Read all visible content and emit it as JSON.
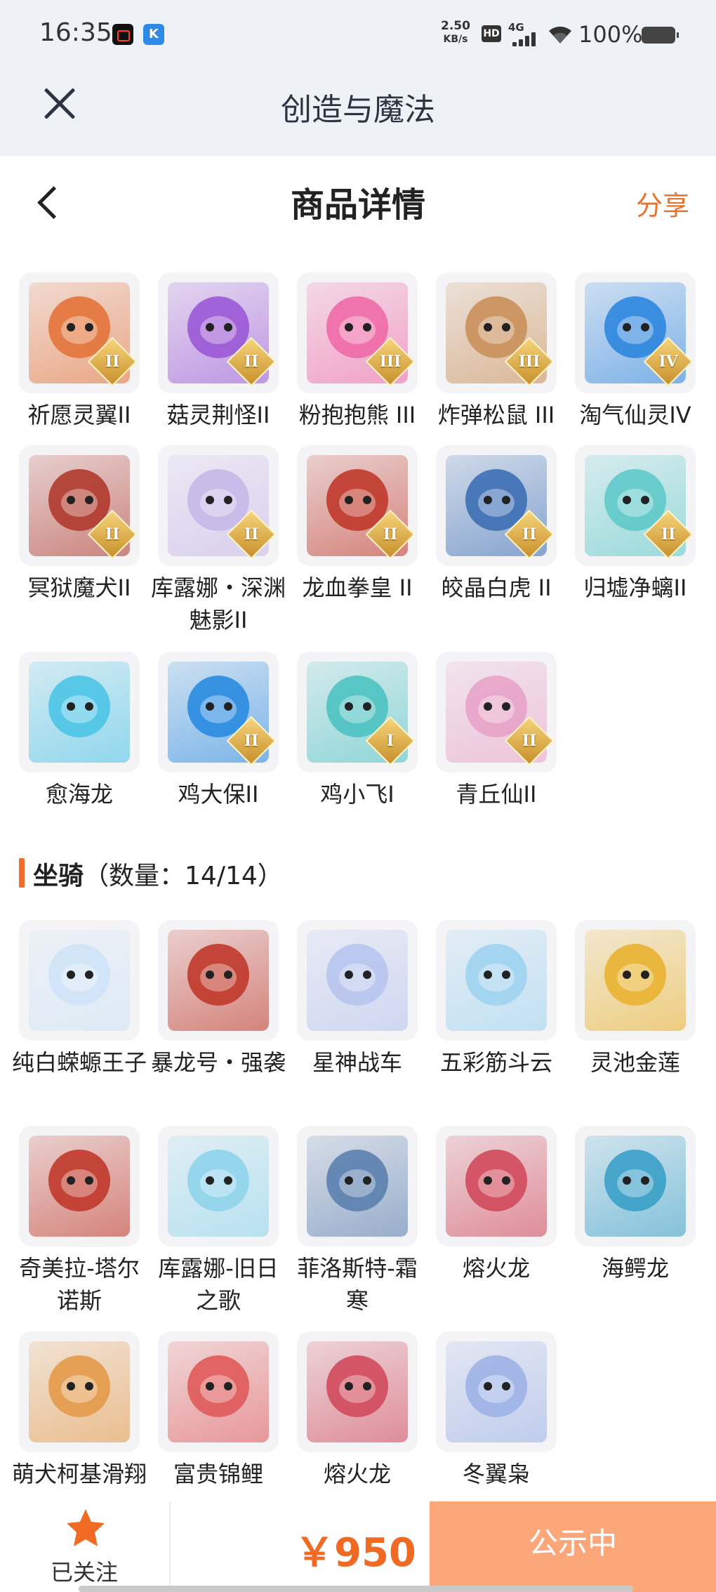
{
  "status_bar": {
    "time": "16:35",
    "net_speed_value": "2.50",
    "net_speed_unit": "KB/s",
    "hd": "HD",
    "signal": "4G",
    "battery": "100%"
  },
  "app_bar": {
    "title": "创造与魔法"
  },
  "page_header": {
    "title": "商品详情",
    "share": "分享"
  },
  "pets": [
    {
      "name": "祈愿灵翼II",
      "tier": "II",
      "icon": "winged-bird-pet",
      "color": "#e3733a"
    },
    {
      "name": "菇灵荆怪II",
      "tier": "II",
      "icon": "purple-mushroom-pet",
      "color": "#9b59d6"
    },
    {
      "name": "粉抱抱熊 III",
      "tier": "III",
      "icon": "pink-bear-pet",
      "color": "#ee6aa7"
    },
    {
      "name": "炸弹松鼠 III",
      "tier": "III",
      "icon": "squirrel-pet",
      "color": "#c9905a"
    },
    {
      "name": "淘气仙灵IV",
      "tier": "IV",
      "icon": "blue-dog-pet",
      "color": "#2e86de"
    },
    {
      "name": "冥狱魔犬II",
      "tier": "II",
      "icon": "hell-hound-pet",
      "color": "#b03a2e"
    },
    {
      "name": "库露娜・深渊魅影II",
      "tier": "II",
      "icon": "abyss-maiden-pet",
      "color": "#c7b8e8"
    },
    {
      "name": "龙血拳皇 II",
      "tier": "II",
      "icon": "dragon-fighter-pet",
      "color": "#c0392b"
    },
    {
      "name": "皎晶白虎 II",
      "tier": "II",
      "icon": "white-tiger-pet",
      "color": "#3d6fb4"
    },
    {
      "name": "归墟净螭II",
      "tier": "II",
      "icon": "jade-dragon-pet",
      "color": "#5fc9c9"
    },
    {
      "name": "愈海龙",
      "tier": "",
      "icon": "sea-dragon-pet",
      "color": "#4dc4e6"
    },
    {
      "name": "鸡大保II",
      "tier": "II",
      "icon": "blue-bird-pet",
      "color": "#2a8be0"
    },
    {
      "name": "鸡小飞I",
      "tier": "I",
      "icon": "chick-pet",
      "color": "#4ec2c2"
    },
    {
      "name": "青丘仙II",
      "tier": "II",
      "icon": "fox-fairy-pet",
      "color": "#e7a3c8"
    }
  ],
  "mounts_section": {
    "title": "坐骑",
    "count_label": "（数量：14/14）"
  },
  "mounts": [
    {
      "name": "纯白蝾螈王子",
      "icon": "white-axolotl-mount",
      "color": "#cfe3f7"
    },
    {
      "name": "暴龙号・强袭",
      "icon": "mecha-dragon-mount",
      "color": "#c0392b"
    },
    {
      "name": "星神战车",
      "icon": "celestial-horse-mount",
      "color": "#b7c4ee"
    },
    {
      "name": "五彩筋斗云",
      "icon": "cloud-mount",
      "color": "#9fd3f0"
    },
    {
      "name": "灵池金莲",
      "icon": "golden-lotus-mount",
      "color": "#e9b331"
    },
    {
      "name": "奇美拉-塔尔诺斯",
      "icon": "chimera-mount",
      "color": "#c0392b"
    },
    {
      "name": "库露娜-旧日之歌",
      "icon": "cloud-maiden-mount",
      "color": "#8fd4ec"
    },
    {
      "name": "菲洛斯特-霜寒",
      "icon": "frost-dragon-mount",
      "color": "#5b7fae"
    },
    {
      "name": "熔火龙",
      "icon": "lava-dragon-mount",
      "color": "#d04a5c"
    },
    {
      "name": "海鳄龙",
      "icon": "sea-croc-dragon-mount",
      "color": "#3aa0c8"
    },
    {
      "name": "萌犬柯基滑翔",
      "icon": "corgi-glider-mount",
      "color": "#e39a4a"
    },
    {
      "name": "富贵锦鲤",
      "icon": "koi-mount",
      "color": "#e05a5a"
    },
    {
      "name": "熔火龙",
      "icon": "lava-dragon-mount",
      "color": "#d04a5c"
    },
    {
      "name": "冬翼枭",
      "icon": "winter-owl-mount",
      "color": "#9db2e6"
    }
  ],
  "bottom_bar": {
    "follow_label": "已关注",
    "price": "￥950",
    "status_button": "公示中"
  },
  "colors": {
    "accent": "#e6732e",
    "price": "#f06a24",
    "button": "#fca77a"
  }
}
